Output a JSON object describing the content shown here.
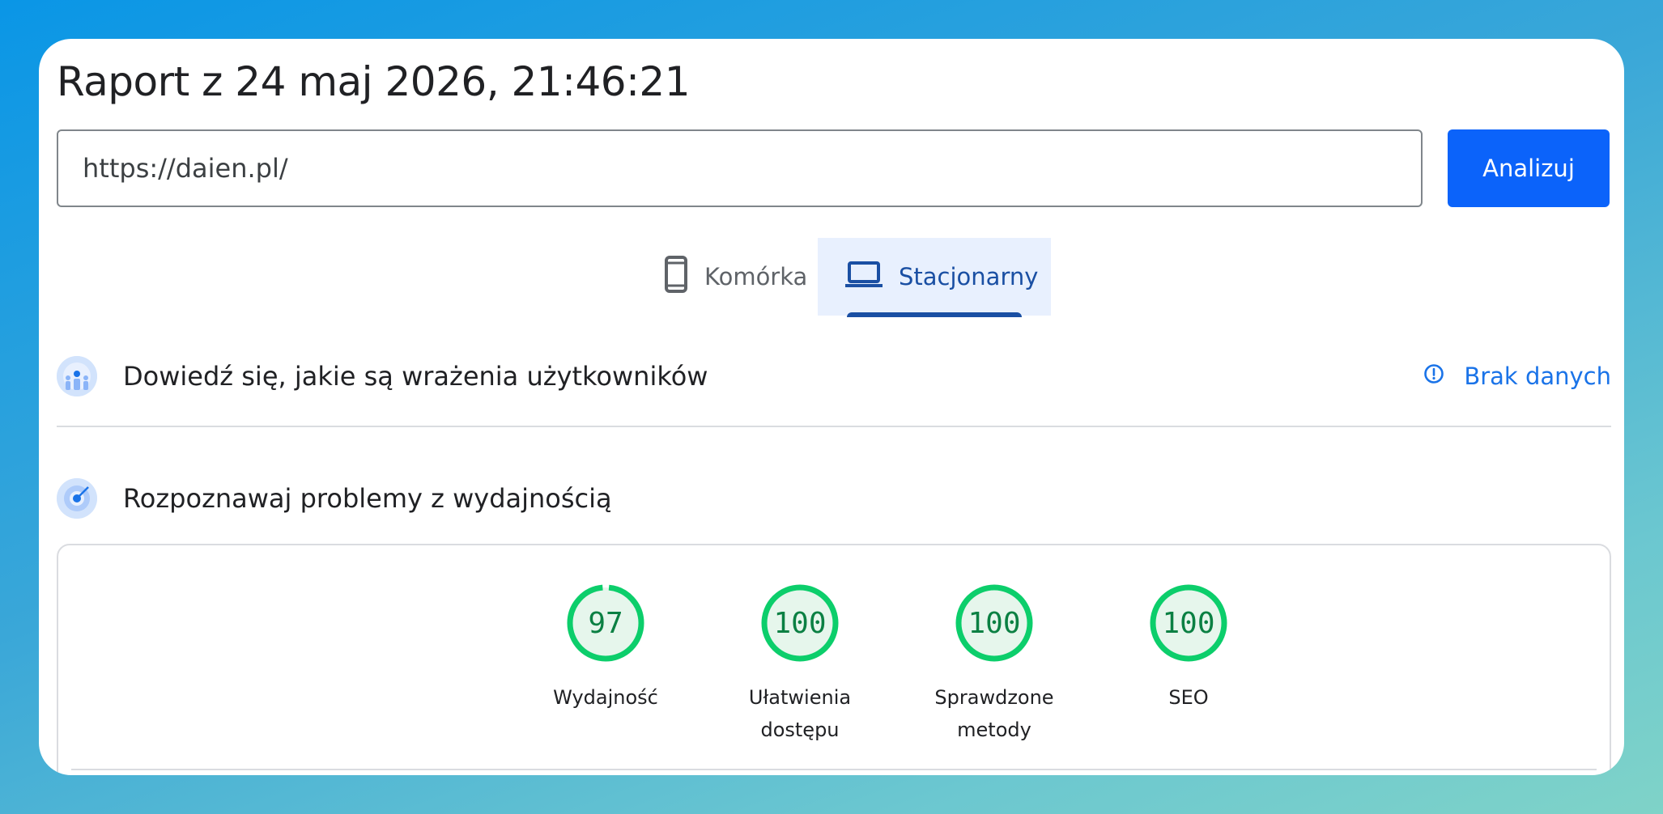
{
  "report": {
    "title": "Raport z 24 maj 2026, 21:46:21"
  },
  "search": {
    "url_value": "https://daien.pl/",
    "analyze_label": "Analizuj"
  },
  "tabs": [
    {
      "label": "Komórka",
      "icon": "phone-icon",
      "selected": false
    },
    {
      "label": "Stacjonarny",
      "icon": "laptop-icon",
      "selected": true
    }
  ],
  "sections": {
    "experience": {
      "title": "Dowiedź się, jakie są wrażenia użytkowników",
      "icon": "users-globe-icon",
      "status_label": "Brak danych",
      "status_icon": "info-circle-icon"
    },
    "performance": {
      "title": "Rozpoznawaj problemy z wydajnością",
      "icon": "radar-icon"
    }
  },
  "scores": [
    {
      "value": "97",
      "fraction": 0.97,
      "label": "Wydajność"
    },
    {
      "value": "100",
      "fraction": 1.0,
      "label": "Ułatwienia\ndostępu"
    },
    {
      "value": "100",
      "fraction": 1.0,
      "label": "Sprawdzone\nmetody"
    },
    {
      "value": "100",
      "fraction": 1.0,
      "label": "SEO"
    }
  ],
  "colors": {
    "accent": "#0b63fa",
    "tab_selected_bg": "#e8f0fe",
    "tab_selected_text": "#1a4fa3",
    "score_good_ring": "#0cce6b",
    "score_good_fill": "#e6f6ec",
    "score_good_text": "#0b8043",
    "link": "#1a73e8"
  }
}
